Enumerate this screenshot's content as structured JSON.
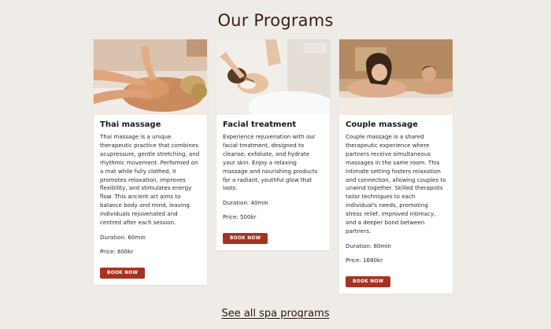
{
  "page": {
    "title": "Our Programs",
    "see_all_label": "See all spa programs"
  },
  "colors": {
    "background": "#efebe7",
    "card": "#ffffff",
    "button": "#a63322",
    "title": "#3a1f14"
  },
  "programs": [
    {
      "title": "Thai massage",
      "description": "Thai massage is a unique therapeutic practice that combines acupressure, gentle stretching, and rhythmic movement. Performed on a mat while fully clothed, it promotes relaxation, improves flexibility, and stimulates energy flow. This ancient art aims to balance body and mind, leaving individuals rejuvenated and centred after each session.",
      "duration": "Duration: 60min",
      "price": "Price: 600kr",
      "button_label": "BOOK NOW",
      "image": "thai-massage-photo"
    },
    {
      "title": "Facial treatment",
      "description": "Experience rejuvenation with our facial treatment, designed to cleanse, exfoliate, and hydrate your skin. Enjoy a relaxing massage and nourishing products for a radiant, youthful glow that lasts.",
      "duration": "Duration: 40min",
      "price": "Price: 500kr",
      "button_label": "BOOK NOW",
      "image": "facial-treatment-photo"
    },
    {
      "title": "Couple massage",
      "description": "Couple massage is a shared therapeutic experience where partners receive simultaneous massages in the same room. This intimate setting fosters relaxation and connection, allowing couples to unwind together. Skilled therapists tailor techniques to each individual's needs, promoting stress relief, improved intimacy, and a deeper bond between partners.",
      "duration": "Duration: 80min",
      "price": "Price: 1680kr",
      "button_label": "BOOK NOW",
      "image": "couple-massage-photo"
    }
  ]
}
